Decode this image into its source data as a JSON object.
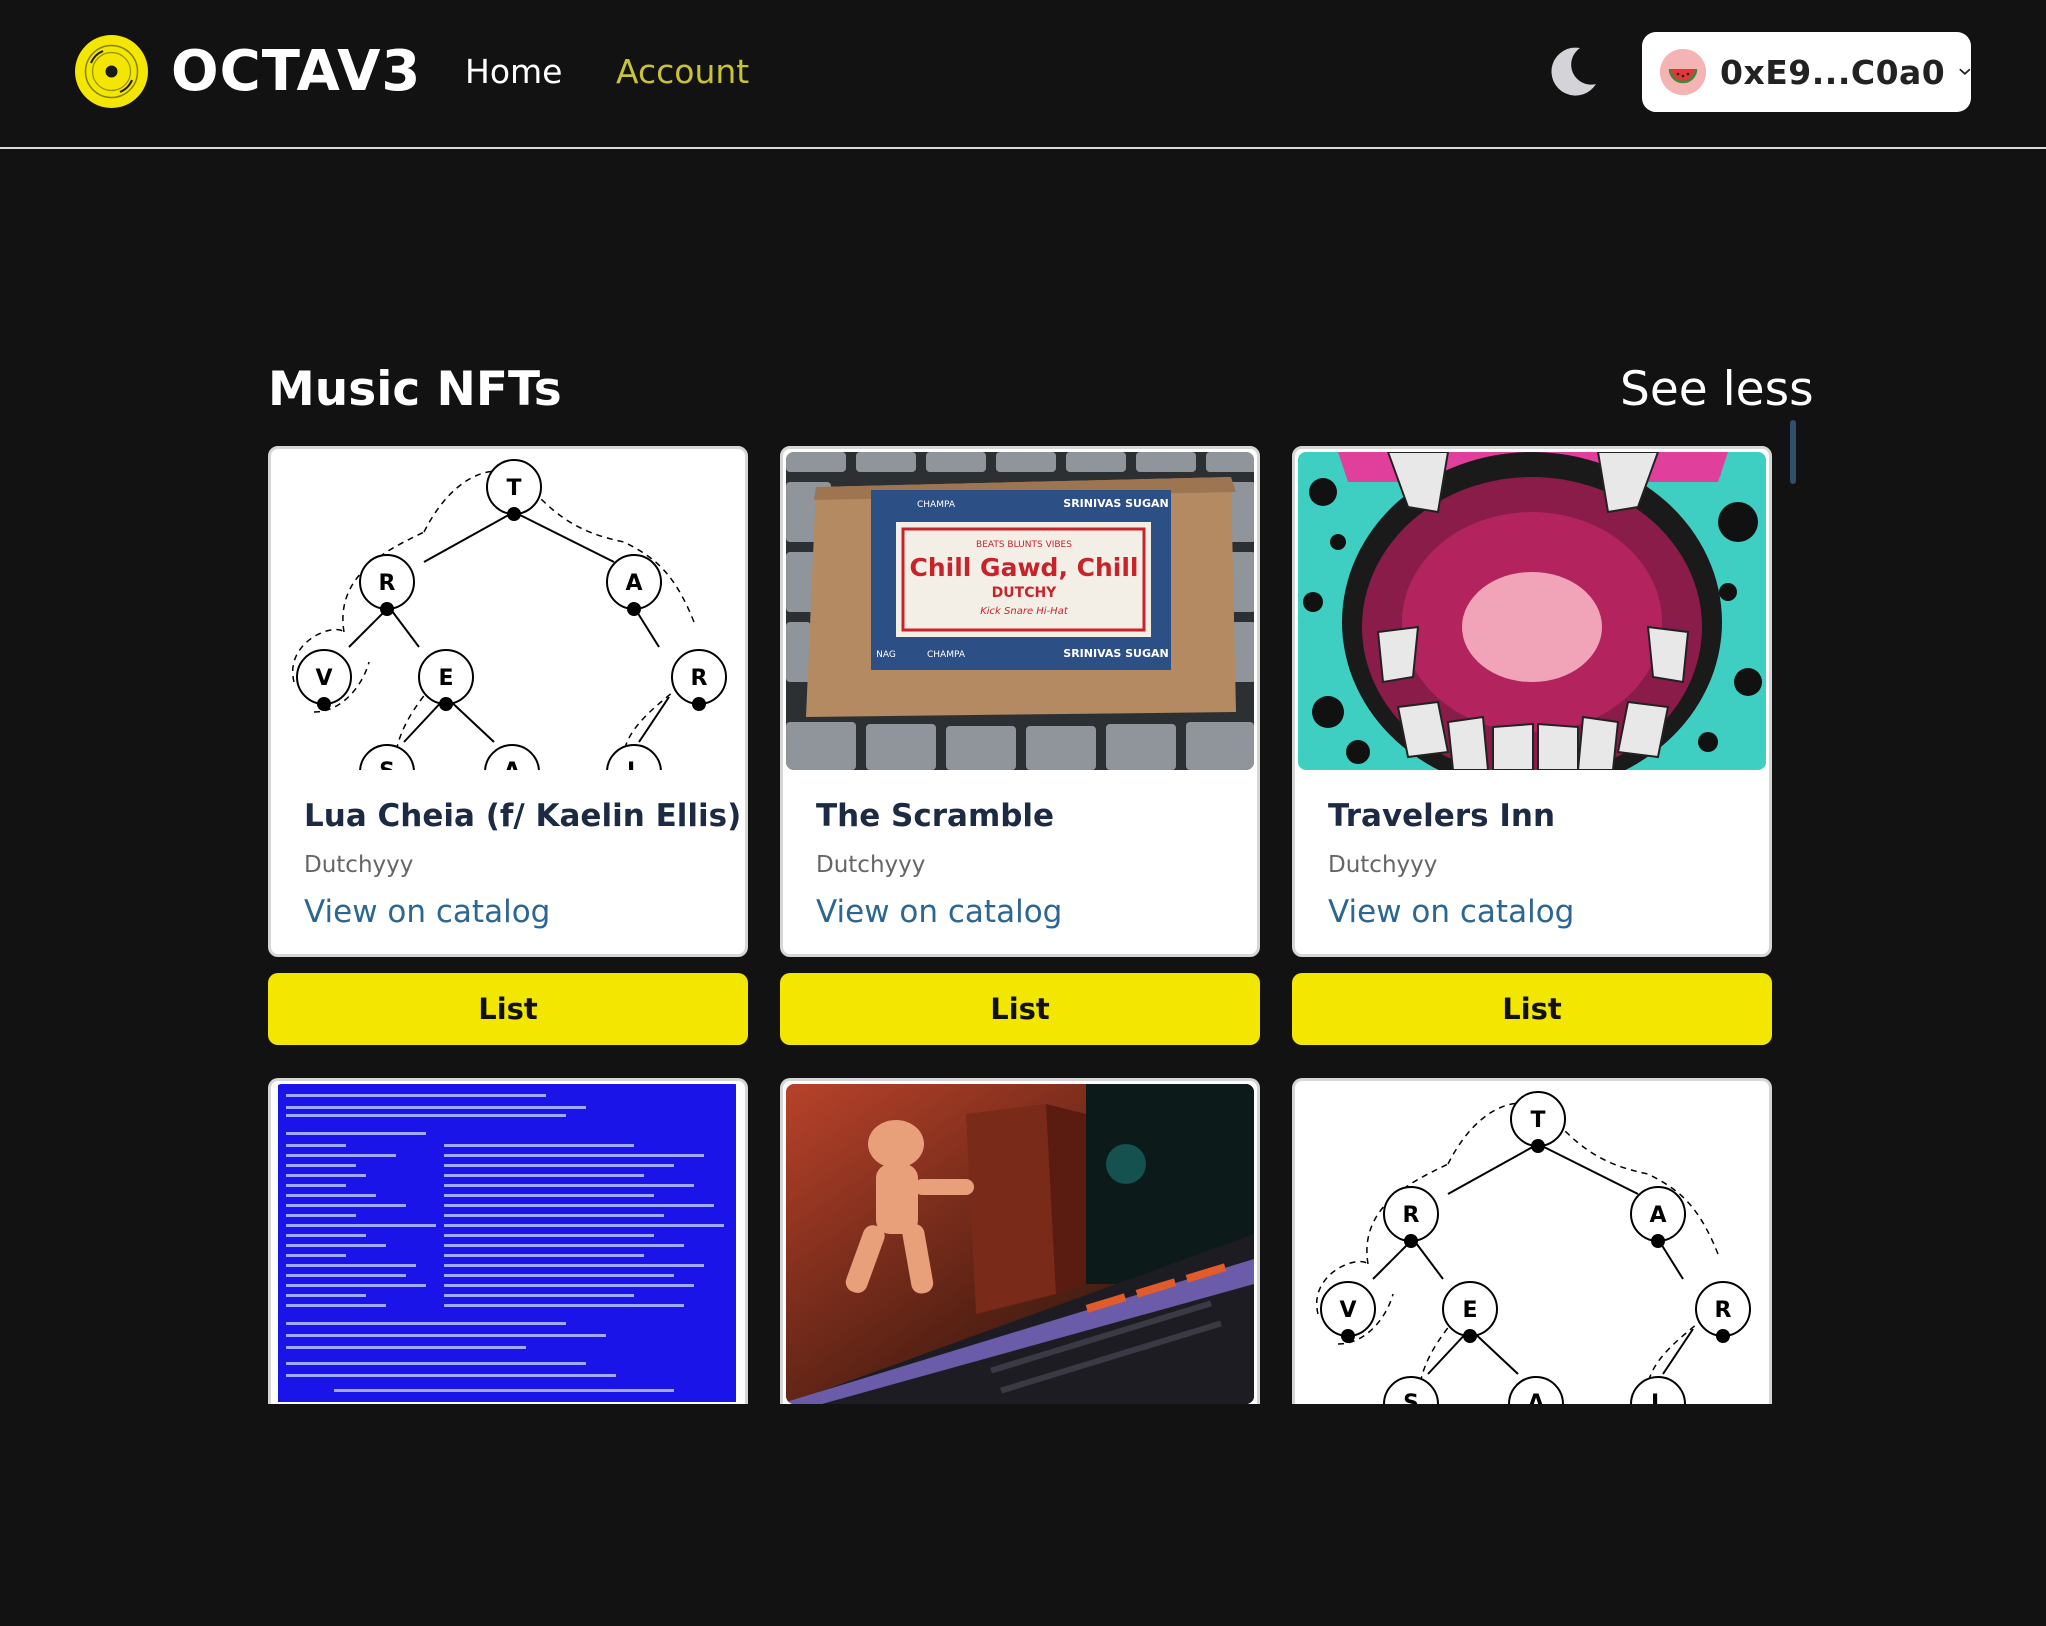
{
  "header": {
    "brand": "OCTAV3",
    "nav": {
      "home": "Home",
      "account": "Account"
    },
    "wallet": {
      "address": "0xE9...C0a0"
    }
  },
  "section": {
    "title": "Music NFTs",
    "toggle": "See less"
  },
  "cards": [
    {
      "title": "Lua Cheia (f/ Kaelin Ellis)",
      "artist": "Dutchyyy",
      "link": "View on catalog",
      "button": "List",
      "art": "tree-diagram"
    },
    {
      "title": "The Scramble",
      "artist": "Dutchyyy",
      "link": "View on catalog",
      "button": "List",
      "art": "incense-box",
      "art_text": {
        "top": "BEATS  BLUNTS  VIBES",
        "main": "Chill Gawd, Chill",
        "sub": "DUTCHY",
        "small": "Kick Snare Hi-Hat",
        "brand": "SRINIVAS SUGAN",
        "champa": "CHAMPA",
        "nag": "NAG"
      }
    },
    {
      "title": "Travelers Inn",
      "artist": "Dutchyyy",
      "link": "View on catalog",
      "button": "List",
      "art": "open-mouth"
    }
  ],
  "thumbs": [
    {
      "art": "blue-screen"
    },
    {
      "art": "astronaut-screen"
    },
    {
      "art": "tree-diagram"
    }
  ],
  "tree_nodes": [
    "T",
    "R",
    "A",
    "V",
    "E",
    "R",
    "S",
    "A",
    "L"
  ],
  "colors": {
    "background": "#121212",
    "accent": "#f3e600",
    "account_link": "#c8c23a",
    "catalog_link": "#2c6692",
    "title_text": "#1c2a44"
  }
}
